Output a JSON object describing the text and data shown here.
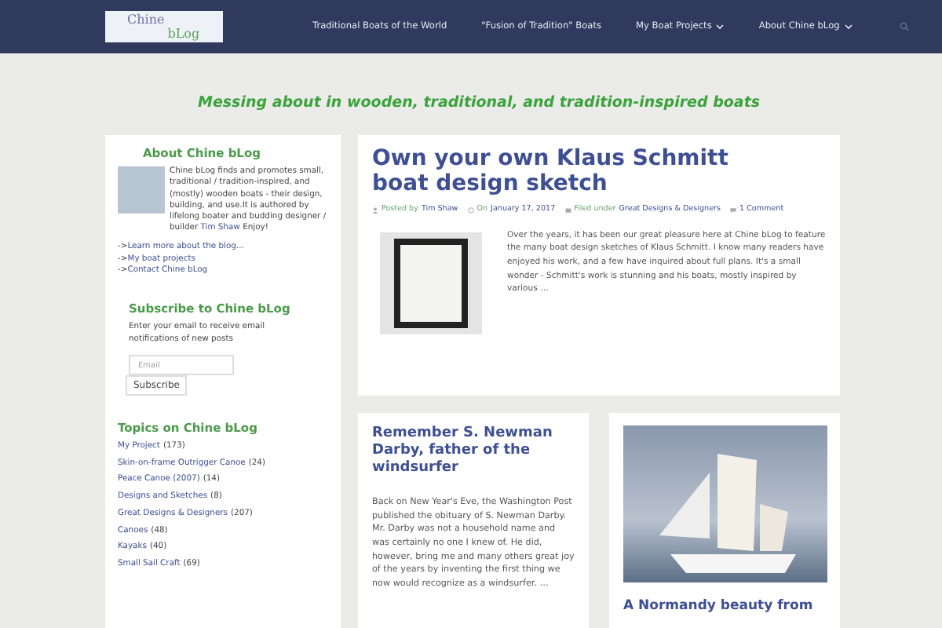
{
  "header": {
    "logo": {
      "word_1": "Chine",
      "word_2": "bLog"
    },
    "nav": [
      {
        "label": "Traditional Boats of the World",
        "has_submenu": false
      },
      {
        "label": "\"Fusion of Tradition\" Boats",
        "has_submenu": false
      },
      {
        "label": "My Boat Projects",
        "has_submenu": true
      },
      {
        "label": "About Chine bLog",
        "has_submenu": true
      }
    ]
  },
  "tagline": "Messing about in wooden, traditional, and tradition-inspired boats",
  "sidebar": {
    "about": {
      "title": "About Chine bLog",
      "bio": "Chine bLog finds and promotes small, traditional / tradition-inspired, and (mostly) wooden boats - their design, building, and use.It is authored by lifelong boater and budding designer / builder",
      "bio_link": "Tim Shaw",
      "bio_end": "Enjoy!",
      "links": [
        {
          "prefix": "->",
          "label": "Learn more about the blog..."
        },
        {
          "prefix": "->",
          "label": "My boat projects"
        },
        {
          "prefix": "->",
          "label": "Contact Chine bLog"
        }
      ]
    },
    "subscribe": {
      "title": "Subscribe to Chine bLog",
      "text": "Enter your email to receive email notifications of new posts",
      "placeholder": "Email",
      "button": "Subscribe"
    },
    "topics": {
      "title": "Topics on Chine bLog",
      "items": [
        {
          "label": "My Project",
          "count": "(173)"
        },
        {
          "label": "Skin-on-frame Outrigger Canoe",
          "count": "(24)"
        },
        {
          "label": "Peace Canoe (2007)",
          "count": "(14)"
        },
        {
          "label": "Designs and Sketches",
          "count": "(8)"
        },
        {
          "label": "Great Designs & Designers",
          "count": "(207)"
        },
        {
          "label": "Canoes",
          "count": "(48)"
        },
        {
          "label": "Kayaks",
          "count": "(40)"
        },
        {
          "label": "Small Sail Craft",
          "count": "(69)"
        }
      ]
    }
  },
  "featured": {
    "title": "Own your own Klaus Schmitt boat design sketch",
    "posted_label": "Posted by",
    "author": "Tim Shaw",
    "date_label": "On",
    "date": "January 17, 2017",
    "filed_label": "Filed under",
    "category": "Great Designs & Designers",
    "comments": "1 Comment",
    "excerpt": "Over the years, it has been our great pleasure here at Chine bLog to feature the many boat design sketches of Klaus Schmitt. I know many readers have enjoyed his work, and a few have inquired about full plans. It's a small wonder - Schmitt's work is stunning and his boats, mostly inspired by various …"
  },
  "posts": [
    {
      "kind": "text",
      "title": "Remember S. Newman Darby, father of the windsurfer",
      "excerpt": "Back on New Year's Eve, the Washington Post published the obituary of S. Newman Darby. Mr. Darby was not a household name and was certainly no one I knew of. He did, however, bring me and many others great joy of the years by inventing the first thing we now would recognize as a windsurfer. …"
    },
    {
      "kind": "photo",
      "title": "A Normandy beauty from"
    }
  ]
}
